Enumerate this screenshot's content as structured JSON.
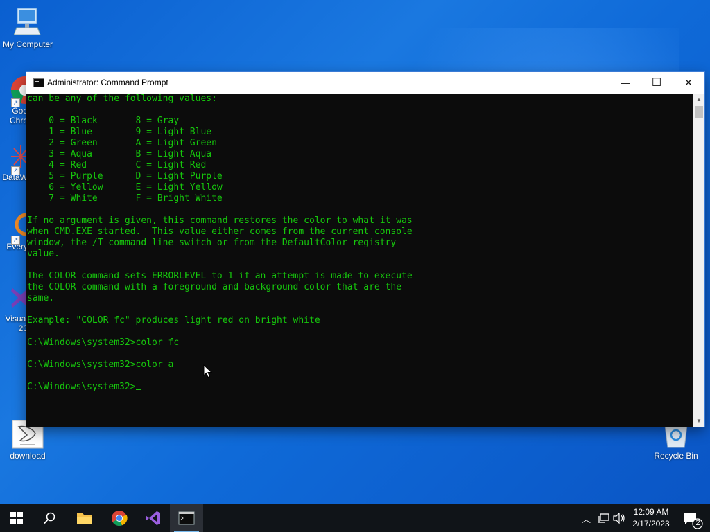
{
  "desktop": {
    "icons": [
      {
        "label": "My Computer"
      },
      {
        "label": "Goo\nChro"
      },
      {
        "label": "DataW"
      },
      {
        "label": "Every"
      },
      {
        "label": "Visual\n20"
      },
      {
        "label": "download"
      },
      {
        "label": "Recycle Bin"
      }
    ]
  },
  "window": {
    "title": "Administrator:  Command Prompt",
    "minimize_glyph": "—",
    "maximize_glyph": "☐",
    "close_glyph": "✕"
  },
  "console": {
    "lines": [
      "can be any of the following values:",
      "",
      "    0 = Black       8 = Gray",
      "    1 = Blue        9 = Light Blue",
      "    2 = Green       A = Light Green",
      "    3 = Aqua        B = Light Aqua",
      "    4 = Red         C = Light Red",
      "    5 = Purple      D = Light Purple",
      "    6 = Yellow      E = Light Yellow",
      "    7 = White       F = Bright White",
      "",
      "If no argument is given, this command restores the color to what it was",
      "when CMD.EXE started.  This value either comes from the current console",
      "window, the /T command line switch or from the DefaultColor registry",
      "value.",
      "",
      "The COLOR command sets ERRORLEVEL to 1 if an attempt is made to execute",
      "the COLOR command with a foreground and background color that are the",
      "same.",
      "",
      "Example: \"COLOR fc\" produces light red on bright white",
      "",
      "C:\\Windows\\system32>color fc",
      "",
      "C:\\Windows\\system32>color a",
      ""
    ],
    "prompt": "C:\\Windows\\system32>",
    "text_color": "#16c60c"
  },
  "taskbar": {
    "clock_time": "12:09 AM",
    "clock_date": "2/17/2023",
    "notification_count": "2",
    "accent": "#76b9ed"
  }
}
